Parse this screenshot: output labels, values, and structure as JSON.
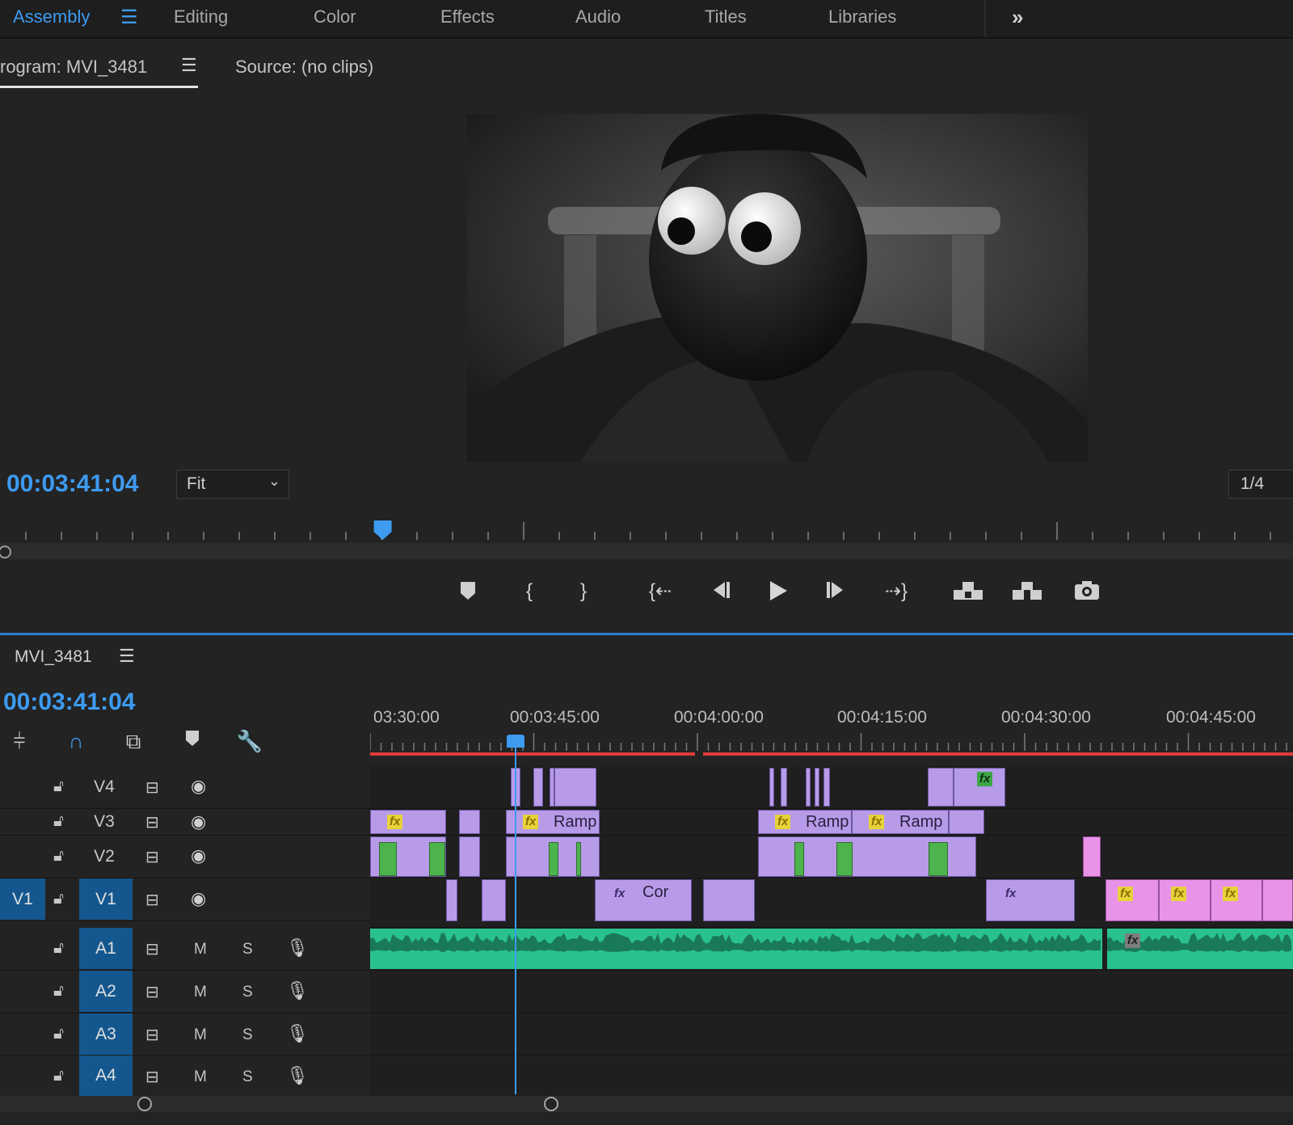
{
  "workspaces": {
    "items": [
      {
        "label": "Assembly",
        "active": true
      },
      {
        "label": "Editing"
      },
      {
        "label": "Color"
      },
      {
        "label": "Effects"
      },
      {
        "label": "Audio"
      },
      {
        "label": "Titles"
      },
      {
        "label": "Libraries"
      }
    ],
    "menu_icon": "hamburger-icon",
    "more_icon": "double-chevron-right-icon"
  },
  "monitor": {
    "program_tab": "rogram: MVI_3481",
    "source_tab": "Source: (no clips)",
    "timecode": "00:03:41:04",
    "fit_value": "Fit",
    "resolution_value": "1/4",
    "playhead_position": 0.296
  },
  "transport": {
    "buttons": [
      {
        "name": "add-marker-button",
        "icon": "marker-icon"
      },
      {
        "name": "mark-in-button",
        "icon": "mark-in-icon"
      },
      {
        "name": "mark-out-button",
        "icon": "mark-out-icon"
      },
      {
        "name": "go-to-in-button",
        "icon": "go-to-in-icon"
      },
      {
        "name": "step-back-button",
        "icon": "step-back-icon"
      },
      {
        "name": "play-button",
        "icon": "play-icon"
      },
      {
        "name": "step-forward-button",
        "icon": "step-forward-icon"
      },
      {
        "name": "go-to-out-button",
        "icon": "go-to-out-icon"
      },
      {
        "name": "lift-button",
        "icon": "lift-icon"
      },
      {
        "name": "extract-button",
        "icon": "extract-icon"
      },
      {
        "name": "export-frame-button",
        "icon": "camera-icon"
      }
    ]
  },
  "timeline": {
    "sequence_name": "MVI_3481",
    "timecode": "00:03:41:04",
    "tools": [
      "insert-track-icon",
      "snap-icon",
      "linked-selection-icon",
      "add-marker-icon",
      "wrench-icon"
    ],
    "time_labels": [
      "03:30:00",
      "00:03:45:00",
      "00:04:00:00",
      "00:04:15:00",
      "00:04:30:00",
      "00:04:45:00"
    ],
    "video_tracks": [
      {
        "name": "V4"
      },
      {
        "name": "V3"
      },
      {
        "name": "V2"
      },
      {
        "name": "V1",
        "source": "V1"
      }
    ],
    "audio_tracks": [
      {
        "name": "A1",
        "mute": "M",
        "solo": "S"
      },
      {
        "name": "A2",
        "mute": "M",
        "solo": "S"
      },
      {
        "name": "A3",
        "mute": "M",
        "solo": "S"
      },
      {
        "name": "A4",
        "mute": "M",
        "solo": "S"
      }
    ],
    "clip_labels": {
      "fx": "fx",
      "ramp": "Ramp",
      "cor": "Cor"
    },
    "colors": {
      "clip": "#b79be9",
      "clip_pink": "#e892e8",
      "audio": "#29c28f",
      "accent": "#3d9bf0",
      "render_bar": "#e03b3b",
      "fx_badge": "#e7d23a"
    }
  }
}
